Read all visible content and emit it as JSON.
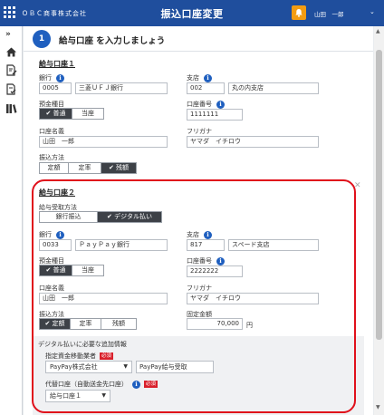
{
  "header": {
    "company": "ＯＢＣ商事株式会社",
    "title": "振込口座変更",
    "user": "山田　一郎",
    "bell_icon": "bell-icon",
    "grid_icon": "app-grid-icon"
  },
  "sidebar": {
    "items": [
      "expand-icon",
      "home-icon",
      "document-edit-icon",
      "document-check-icon",
      "books-icon"
    ]
  },
  "step": {
    "number": "1",
    "title": "給与口座 を入力しましょう"
  },
  "account1": {
    "title": "給与口座１",
    "bank_label": "銀行",
    "bank_code": "0005",
    "bank_name": "三菱ＵＦＪ銀行",
    "branch_label": "支店",
    "branch_code": "002",
    "branch_name": "丸の内支店",
    "type_label": "預金種目",
    "type_options": [
      "普通",
      "当座"
    ],
    "type_selected": 0,
    "number_label": "口座番号",
    "number": "1111111",
    "holder_label": "口座名義",
    "holder": "山田　一郎",
    "kana_label": "フリガナ",
    "kana": "ヤマダ　イチロウ",
    "method_label": "振込方法",
    "method_options": [
      "定額",
      "定率",
      "残額"
    ],
    "method_selected": 2
  },
  "account2": {
    "title": "給与口座２",
    "receive_label": "給与受取方法",
    "receive_options": [
      "銀行振込",
      "デジタル払い"
    ],
    "receive_selected": 1,
    "bank_label": "銀行",
    "bank_code": "0033",
    "bank_name": "ＰａｙＰａｙ銀行",
    "branch_label": "支店",
    "branch_code": "817",
    "branch_name": "スペード支店",
    "type_label": "預金種目",
    "type_options": [
      "普通",
      "当座"
    ],
    "type_selected": 0,
    "number_label": "口座番号",
    "number": "2222222",
    "holder_label": "口座名義",
    "holder": "山田　一郎",
    "kana_label": "フリガナ",
    "kana": "ヤマダ　イチロウ",
    "method_label": "振込方法",
    "method_options": [
      "定額",
      "定率",
      "残額"
    ],
    "method_selected": 0,
    "fixed_label": "固定金額",
    "fixed_amount": "70,000",
    "yen": "円"
  },
  "digital": {
    "heading": "デジタル払いに必要な追加情報",
    "provider_label": "指定資金移動業者",
    "required": "必須",
    "provider_value": "PayPay株式会社",
    "provider_service": "PayPay給与受取",
    "fallback_label": "代替口座（自動送金先口座）",
    "fallback_value": "給与口座１"
  },
  "colors": {
    "header": "#1f4e9d",
    "accent": "#1f5fbf",
    "highlight": "#e0101b",
    "notification": "#f39c12"
  }
}
